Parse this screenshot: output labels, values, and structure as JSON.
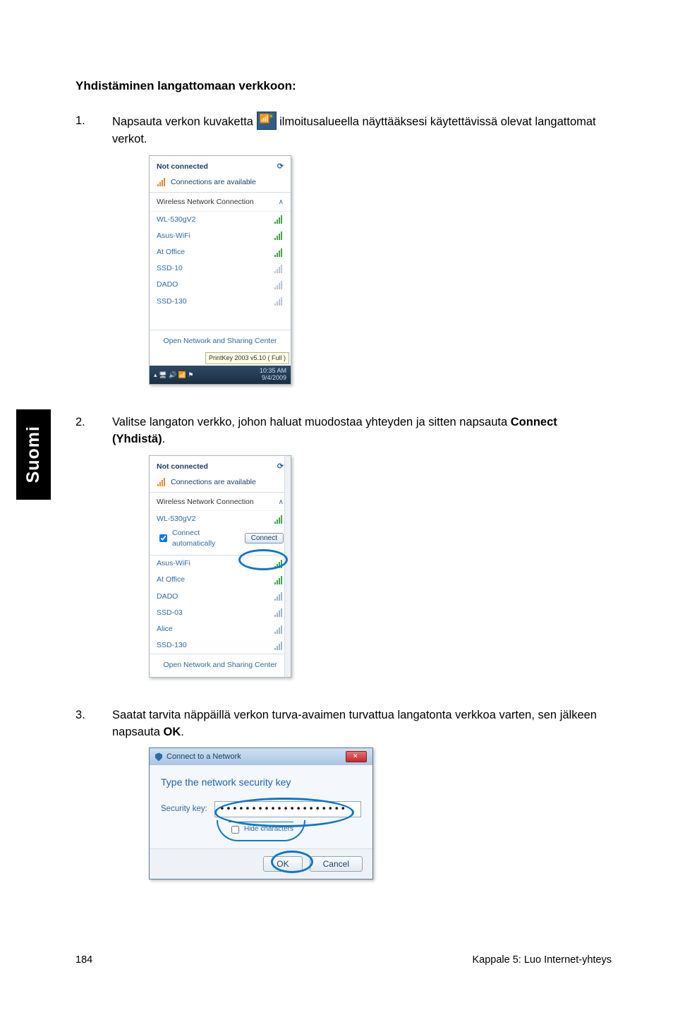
{
  "sidetab": "Suomi",
  "heading": "Yhdistäminen langattomaan verkkoon:",
  "steps": {
    "one": {
      "num": "1.",
      "pre": "Napsauta verkon kuvaketta ",
      "post": " ilmoitusalueella näyttääksesi käytettävissä olevat langattomat verkot."
    },
    "two": {
      "num": "2.",
      "text_pre": "Valitse langaton verkko, johon haluat muodostaa yhteyden ja sitten napsauta ",
      "bold": "Connect (Yhdistä)",
      "text_post": "."
    },
    "three": {
      "num": "3.",
      "text_pre": "Saatat tarvita näppäillä verkon turva-avaimen turvattua langatonta verkkoa varten, sen jälkeen napsauta ",
      "bold": "OK",
      "text_post": "."
    }
  },
  "shot1": {
    "status": "Not connected",
    "avail": "Connections are available",
    "section": "Wireless Network Connection",
    "nets": [
      "WL-530gV2",
      "Asus-WiFi",
      "At Office",
      "SSD-10",
      "DADO",
      "SSD-130"
    ],
    "footer": "Open Network and Sharing Center",
    "tooltip": "PrintKey 2003 v5.10 ( Full )",
    "time": "10:35 AM",
    "date": "9/4/2009"
  },
  "shot2": {
    "status": "Not connected",
    "avail": "Connections are available",
    "section": "Wireless Network Connection",
    "selected": "WL-530gV2",
    "auto": "Connect automatically",
    "connect": "Connect",
    "nets": [
      "Asus-WiFi",
      "At Office",
      "DADO",
      "SSD-03",
      "Alice",
      "SSD-130"
    ],
    "footer": "Open Network and Sharing Center"
  },
  "shot3": {
    "title": "Connect to a Network",
    "prompt": "Type the network security key",
    "label": "Security key:",
    "value": "••••••••••••••••••••",
    "hide": "Hide characters",
    "ok": "OK",
    "cancel": "Cancel"
  },
  "footer": {
    "page": "184",
    "chapter": "Kappale 5: Luo Internet-yhteys"
  }
}
